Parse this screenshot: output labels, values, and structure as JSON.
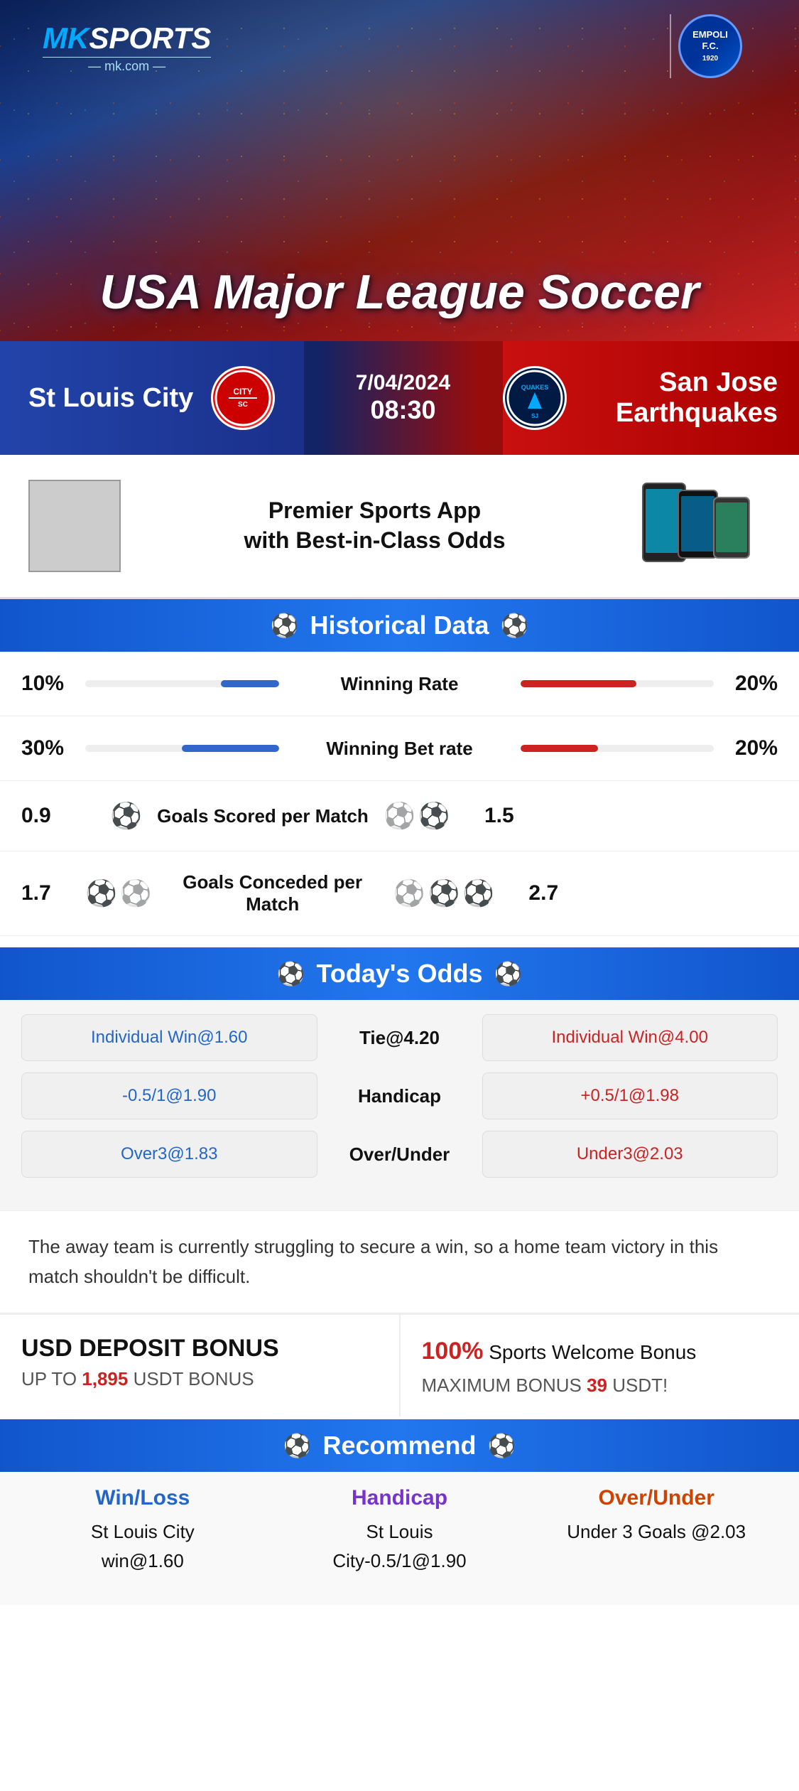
{
  "brand": {
    "name": "MK",
    "sports": "SPORTS",
    "domain": "mk.com"
  },
  "hero": {
    "title": "USA Major League Soccer",
    "partner": "EMPOLI F.C."
  },
  "match": {
    "home_team": "St Louis City",
    "away_team": "San Jose Earthquakes",
    "away_team_short": "QUAKES",
    "date": "7/04/2024",
    "time": "08:30"
  },
  "app_promo": {
    "text": "Premier Sports App\nwith Best-in-Class Odds"
  },
  "historical": {
    "section_title": "Historical Data",
    "stats": [
      {
        "label": "Winning Rate",
        "left_val": "10%",
        "right_val": "20%",
        "left_pct": 30,
        "right_pct": 60,
        "type": "bar"
      },
      {
        "label": "Winning Bet rate",
        "left_val": "30%",
        "right_val": "20%",
        "left_pct": 50,
        "right_pct": 40,
        "type": "bar"
      },
      {
        "label": "Goals Scored per Match",
        "left_val": "0.9",
        "right_val": "1.5",
        "left_balls": 1,
        "right_balls": 2,
        "type": "icons"
      },
      {
        "label": "Goals Conceded per Match",
        "left_val": "1.7",
        "right_val": "2.7",
        "left_balls": 2,
        "right_balls": 3,
        "type": "icons"
      }
    ]
  },
  "odds": {
    "section_title": "Today's Odds",
    "rows": [
      {
        "left": "Individual Win@1.60",
        "center": "Tie@4.20",
        "right": "Individual Win@4.00"
      },
      {
        "left": "-0.5/1@1.90",
        "center": "Handicap",
        "right": "+0.5/1@1.98"
      },
      {
        "left": "Over3@1.83",
        "center": "Over/Under",
        "right": "Under3@2.03"
      }
    ]
  },
  "analysis": {
    "text": "The away team is currently struggling to secure a win, so a home team victory in this match shouldn't be difficult."
  },
  "bonus": {
    "left_title": "USD DEPOSIT BONUS",
    "left_sub": "UP TO",
    "left_amount": "1,895",
    "left_suffix": "USDT BONUS",
    "right_pct": "100%",
    "right_title": "Sports Welcome Bonus",
    "right_sub": "MAXIMUM BONUS",
    "right_amount": "39",
    "right_suffix": "USDT!"
  },
  "recommend": {
    "section_title": "Recommend",
    "cards": [
      {
        "title": "Win/Loss",
        "body": "St Louis City\nwin@1.60"
      },
      {
        "title": "Handicap",
        "body": "St Louis\nCity-0.5/1@1.90"
      },
      {
        "title": "Over/Under",
        "body": "Under 3 Goals @2.03"
      }
    ]
  }
}
